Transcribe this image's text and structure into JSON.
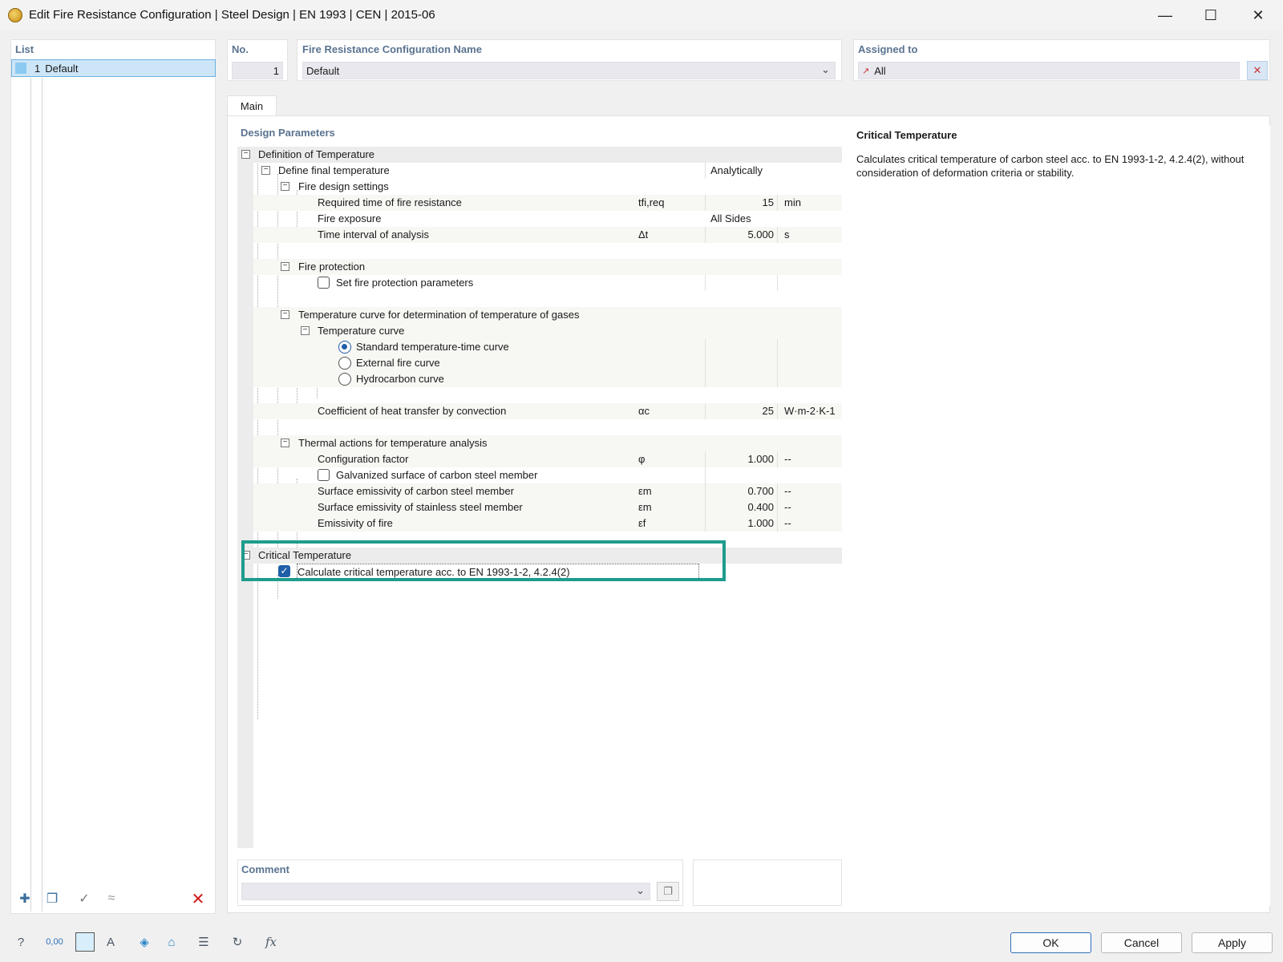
{
  "window": {
    "title": "Edit Fire Resistance Configuration | Steel Design | EN 1993 | CEN | 2015-06",
    "min": "—",
    "max": "☐",
    "close": "✕"
  },
  "list": {
    "label": "List",
    "items": [
      {
        "no": "1",
        "name": "Default"
      }
    ]
  },
  "header": {
    "no_label": "No.",
    "no_value": "1",
    "name_label": "Fire Resistance Configuration Name",
    "name_value": "Default",
    "assigned_label": "Assigned to",
    "assigned_value": "All"
  },
  "tabs": [
    {
      "label": "Main"
    }
  ],
  "params": {
    "label": "Design Parameters",
    "rows": {
      "def_temp": "Definition of Temperature",
      "final_temp": {
        "label": "Define final temperature",
        "value": "Analytically"
      },
      "fire_settings": "Fire design settings",
      "req_time": {
        "label": "Required time of fire resistance",
        "sym": "tfi,req",
        "value": "15",
        "unit": "min"
      },
      "exposure": {
        "label": "Fire exposure",
        "value": "All Sides"
      },
      "interval": {
        "label": "Time interval of analysis",
        "sym": "Δt",
        "value": "5.000",
        "unit": "s"
      },
      "protection": "Fire protection",
      "protection_params": "Set fire protection parameters",
      "temp_curve_gases": "Temperature curve for determination of temperature of gases",
      "temp_curve": "Temperature curve",
      "curve_standard": "Standard temperature-time curve",
      "curve_external": "External fire curve",
      "curve_hydro": "Hydrocarbon curve",
      "coef": {
        "label": "Coefficient of heat transfer by convection",
        "sym": "αc",
        "value": "25",
        "unit": "W·m-2·K-1"
      },
      "thermal": "Thermal actions for temperature analysis",
      "config": {
        "label": "Configuration factor",
        "sym": "φ",
        "value": "1.000",
        "unit": "--"
      },
      "galvanized": "Galvanized surface of carbon steel member",
      "emis_carbon": {
        "label": "Surface emissivity of carbon steel member",
        "sym": "εm",
        "value": "0.700",
        "unit": "--"
      },
      "emis_stainless": {
        "label": "Surface emissivity of stainless steel member",
        "sym": "εm",
        "value": "0.400",
        "unit": "--"
      },
      "emis_fire": {
        "label": "Emissivity of fire",
        "sym": "εf",
        "value": "1.000",
        "unit": "--"
      },
      "critical": "Critical Temperature",
      "calc_critical": "Calculate critical temperature acc. to EN 1993-1-2, 4.2.4(2)"
    }
  },
  "description": {
    "title": "Critical Temperature",
    "text": "Calculates critical temperature of carbon steel acc. to EN 1993-1-2, 4.2.4(2), without consideration of deformation criteria or stability."
  },
  "comment": {
    "label": "Comment",
    "value": ""
  },
  "buttons": {
    "ok": "OK",
    "cancel": "Cancel",
    "apply": "Apply"
  },
  "colors": {
    "accent": "#1f5ea8",
    "highlight": "#1e9c8c",
    "selection": "#cde6f7"
  }
}
